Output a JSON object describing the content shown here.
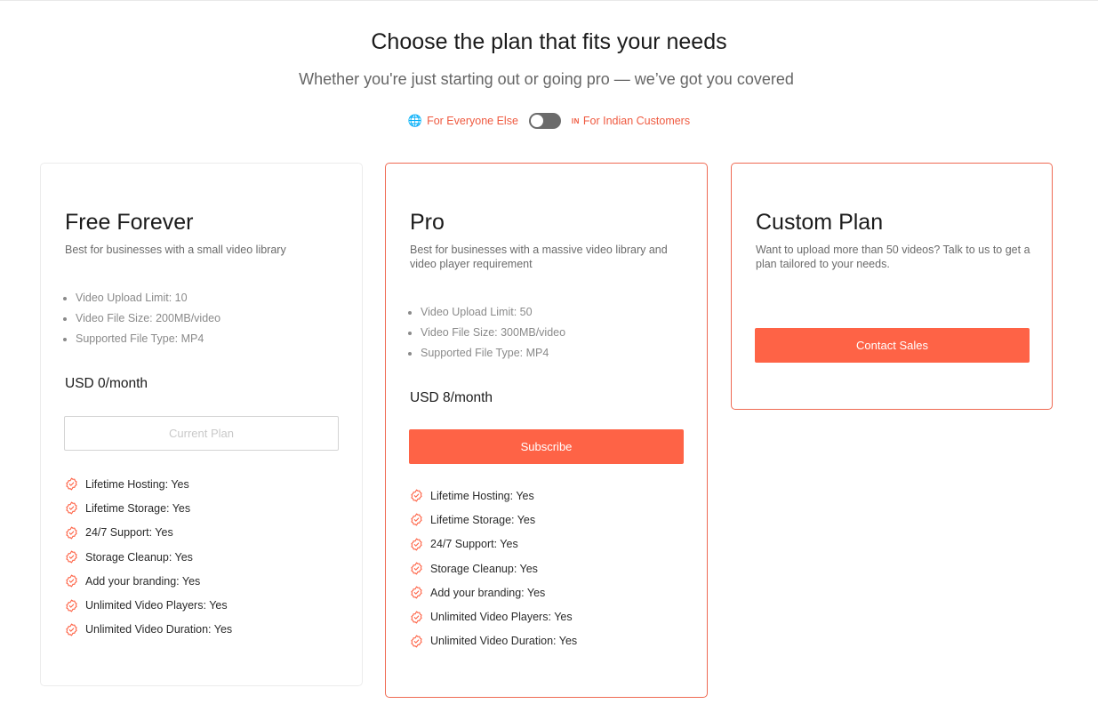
{
  "header": {
    "title": "Choose the plan that fits your needs",
    "subtitle": "Whether you're just starting out or going pro — we’ve got you covered"
  },
  "region_toggle": {
    "left_label": "For Everyone Else",
    "left_icon": "globe-icon",
    "right_label": "For Indian Customers",
    "right_prefix": "IN",
    "selected": "For Everyone Else"
  },
  "colors": {
    "accent": "#fe6346",
    "card_border": "#ef6a53",
    "toggle": "#6b6b6b"
  },
  "plans": [
    {
      "name": "Free Forever",
      "description": "Best for businesses with a small video library",
      "limits": [
        "Video Upload Limit: 10",
        "Video File Size: 200MB/video",
        "Supported File Type: MP4"
      ],
      "price": "USD 0/month",
      "button": "Current Plan",
      "features": [
        "Lifetime Hosting: Yes",
        "Lifetime Storage: Yes",
        "24/7 Support: Yes",
        "Storage Cleanup: Yes",
        "Add your branding: Yes",
        "Unlimited Video Players: Yes",
        "Unlimited Video Duration: Yes"
      ]
    },
    {
      "name": "Pro",
      "description": "Best for businesses with a massive video library and video player requirement",
      "limits": [
        "Video Upload Limit: 50",
        "Video File Size: 300MB/video",
        "Supported File Type: MP4"
      ],
      "price": "USD 8/month",
      "button": "Subscribe",
      "features": [
        "Lifetime Hosting: Yes",
        "Lifetime Storage: Yes",
        "24/7 Support: Yes",
        "Storage Cleanup: Yes",
        "Add your branding: Yes",
        "Unlimited Video Players: Yes",
        "Unlimited Video Duration: Yes"
      ]
    },
    {
      "name": "Custom Plan",
      "description": "Want to upload more than 50 videos? Talk to us to get a plan tailored to your needs.",
      "button": "Contact Sales"
    }
  ]
}
